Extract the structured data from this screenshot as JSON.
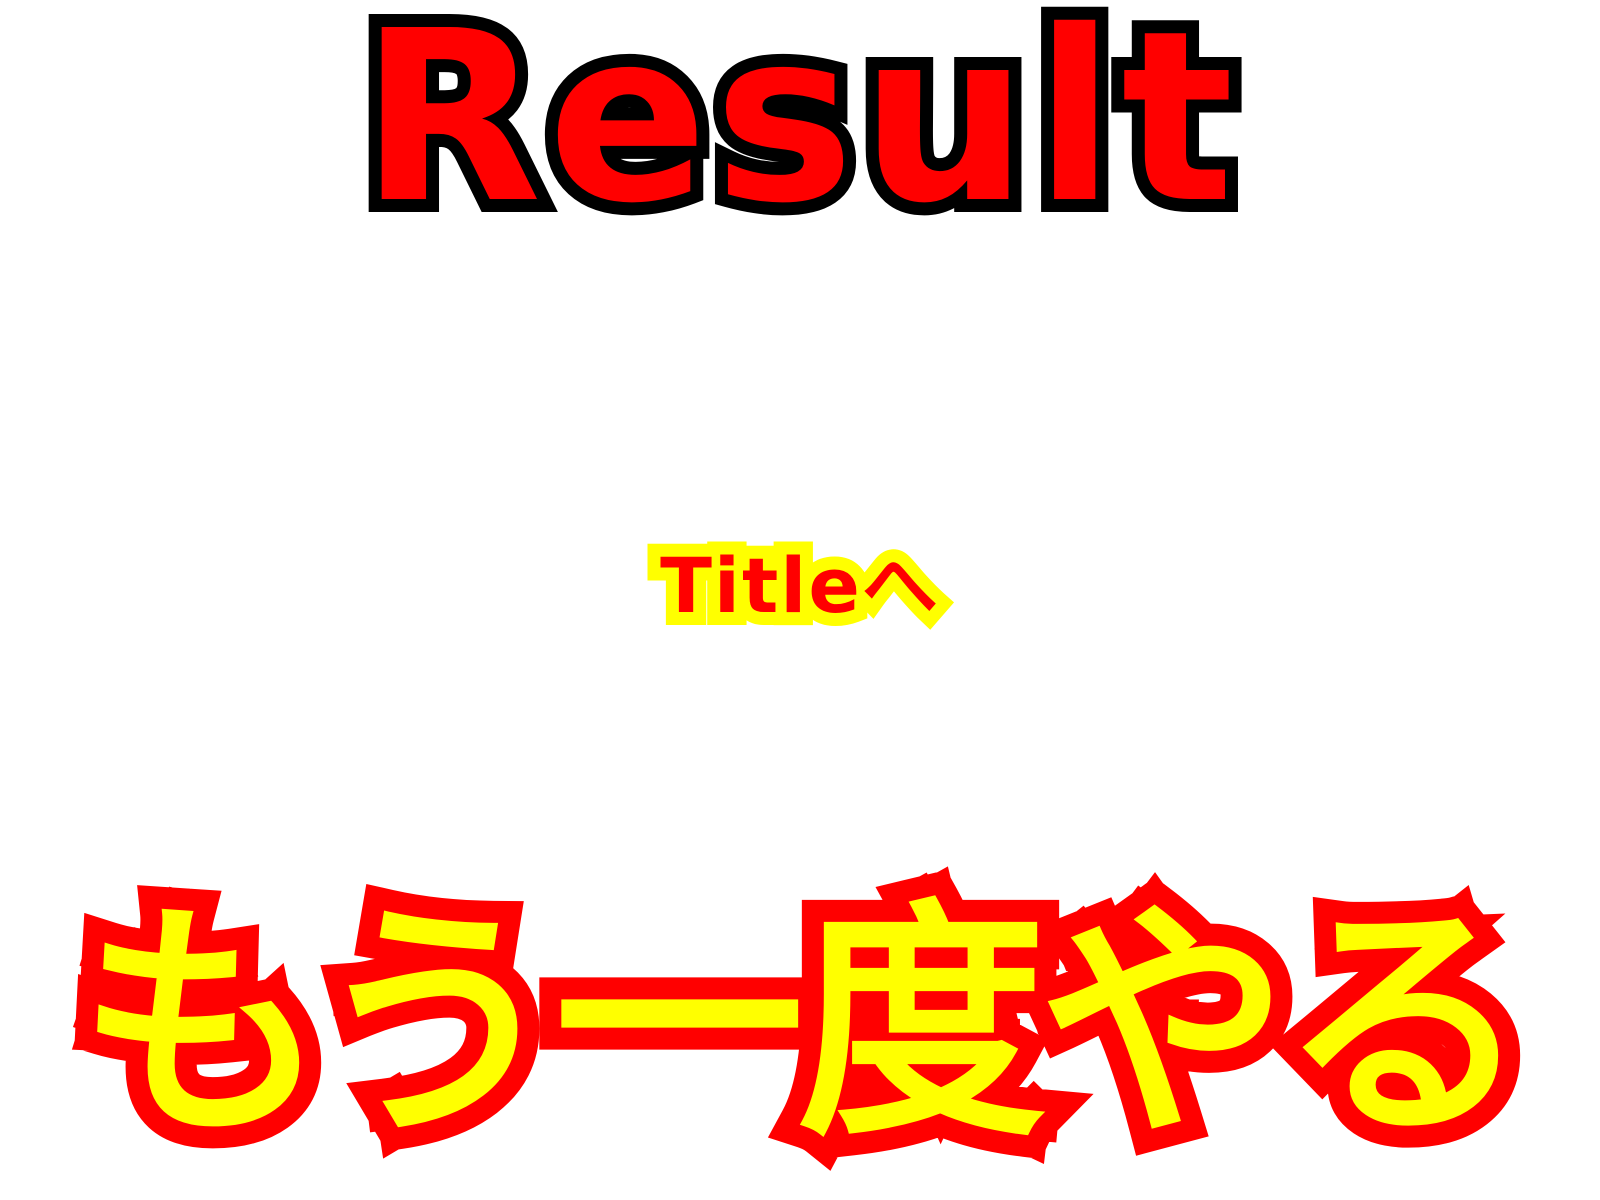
{
  "screen": {
    "name": "result-screen",
    "background": "#ffffff"
  },
  "result": {
    "title": "Result",
    "fill_color": "#ff0000",
    "outline_color": "#000000"
  },
  "buttons": {
    "title": {
      "label": "Titleへ",
      "fill_color": "#ff0000",
      "outline_color": "#ffff00"
    },
    "retry": {
      "label": "もう一度やる",
      "fill_color": "#ffff00",
      "outline_color": "#ff0000"
    }
  }
}
